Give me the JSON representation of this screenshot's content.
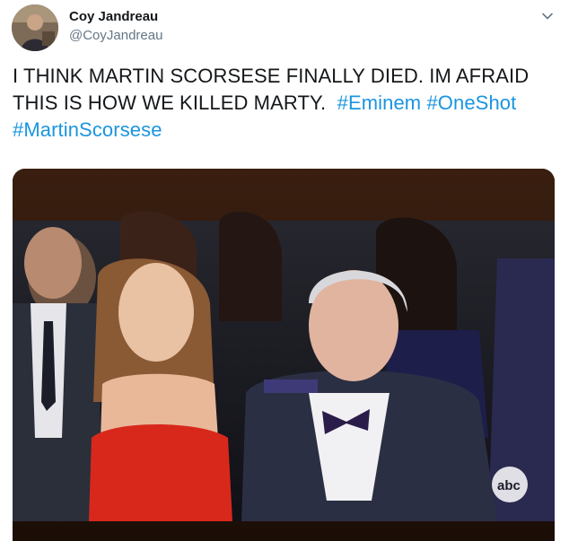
{
  "tweet": {
    "display_name": "Coy Jandreau",
    "handle": "@CoyJandreau",
    "text_line1": "I THINK MARTIN SCORSESE FINALLY DIED. IM AFRAID",
    "text_line2": "THIS IS HOW WE KILLED MARTY.",
    "hashtags": [
      "#Eminem",
      "#OneShot",
      "#MartinScorsese"
    ]
  },
  "media": {
    "network_logo": "abc"
  },
  "icons": {
    "menu": "chevron-down-icon",
    "avatar": "avatar"
  },
  "colors": {
    "hashtag": "#1b95e0",
    "handle": "#657786",
    "text": "#14171a"
  }
}
